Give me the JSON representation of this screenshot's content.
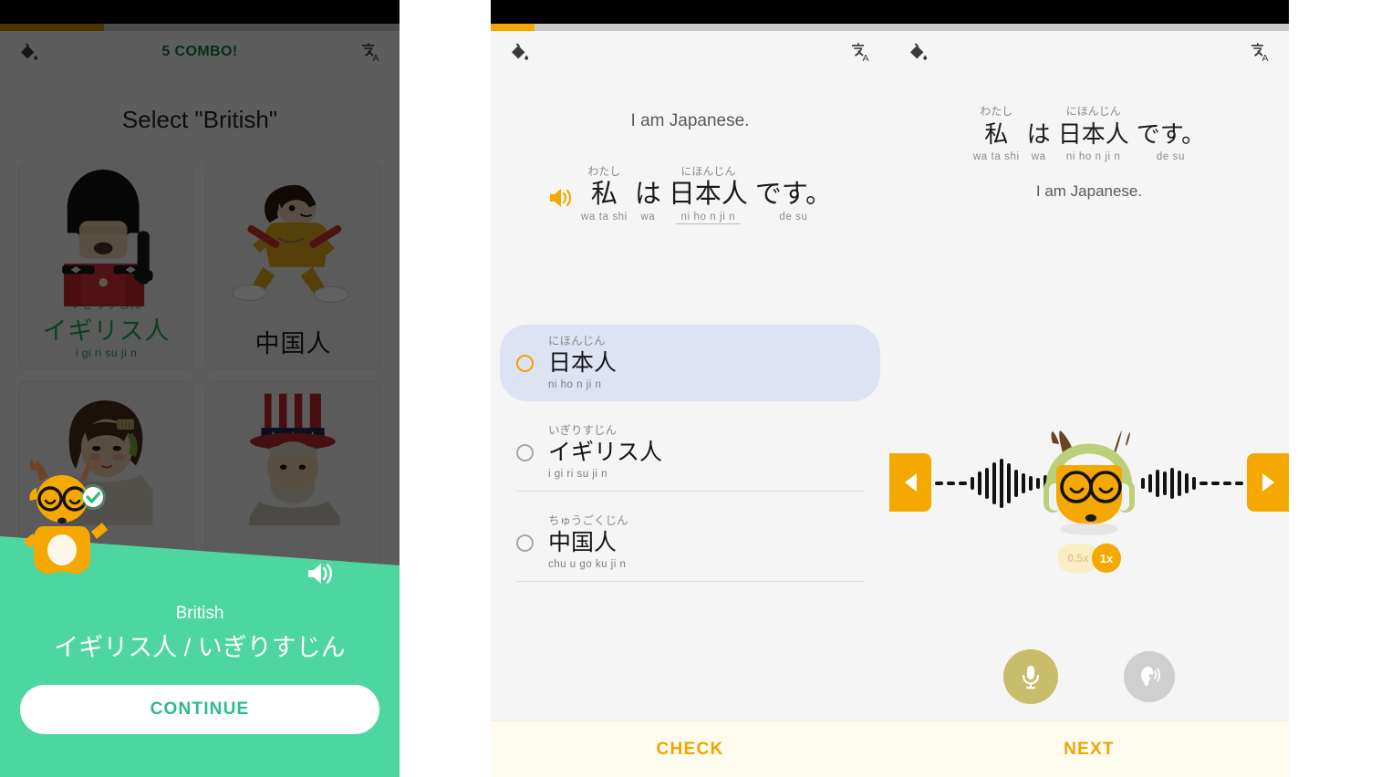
{
  "app": {
    "name": "Japanese learning app",
    "accent_orange": "#f5a800",
    "accent_green": "#4ed6a1",
    "correct_green": "#1fa85f",
    "select_blue": "#dde3f2"
  },
  "panel1": {
    "name": "quiz-result-screen",
    "combo_label": "5 COMBO!",
    "prompt": "Select \"British\"",
    "progress_percent": 26,
    "paint_icon": "paint-bucket-icon",
    "translate_icon": "translate-icon",
    "cards": [
      {
        "furigana": "いぎりすじん",
        "word": "イギリス人",
        "romaji": "i gi ri su ji n",
        "art": "british-guard",
        "selected": true
      },
      {
        "furigana": "",
        "word": "中国人",
        "romaji": "",
        "art": "kungfu-man",
        "selected": false
      },
      {
        "furigana": "",
        "word": "",
        "romaji": "",
        "art": "japanese-woman",
        "selected": false
      },
      {
        "furigana": "",
        "word": "",
        "romaji": "",
        "art": "uncle-sam",
        "selected": false
      }
    ],
    "result": {
      "english": "British",
      "japanese": "イギリス人 / いぎりすじん",
      "continue_label": "CONTINUE",
      "speaker_icon": "speaker-icon",
      "mascot": "deer-mascot-with-check"
    }
  },
  "panel2": {
    "name": "multiple-choice-screen",
    "progress_percent": 11,
    "english": "I am Japanese.",
    "speaker_icon": "speaker-icon",
    "sentence": [
      {
        "furigana": "わたし",
        "kanji": "私",
        "romaji": "wa ta shi",
        "underline": false
      },
      {
        "furigana": "",
        "kanji": "は",
        "romaji": "wa",
        "underline": false
      },
      {
        "furigana": "にほんじん",
        "kanji": "日本人",
        "romaji": "ni ho n ji n",
        "underline": true
      },
      {
        "furigana": "",
        "kanji": "です。",
        "romaji": "de su",
        "underline": false
      }
    ],
    "options": [
      {
        "furigana": "にほんじん",
        "word": "日本人",
        "romaji": "ni ho n ji n",
        "selected": true
      },
      {
        "furigana": "いぎりすじん",
        "word": "イギリス人",
        "romaji": "i gi ri su ji n",
        "selected": false
      },
      {
        "furigana": "ちゅうごくじん",
        "word": "中国人",
        "romaji": "chu u go ku ji n",
        "selected": false
      }
    ],
    "check_label": "CHECK"
  },
  "panel3": {
    "name": "listening-practice-screen",
    "progress_percent": 0,
    "sentence": [
      {
        "furigana": "わたし",
        "kanji": "私",
        "romaji": "wa ta shi"
      },
      {
        "furigana": "",
        "kanji": "は",
        "romaji": "wa"
      },
      {
        "furigana": "にほんじん",
        "kanji": "日本人",
        "romaji": "ni ho n ji n"
      },
      {
        "furigana": "",
        "kanji": "です。",
        "romaji": "de su"
      }
    ],
    "english": "I am Japanese.",
    "speed_half_label": "0.5x",
    "speed_one_label": "1x",
    "mic_icon": "microphone-icon",
    "ear_icon": "ear-listen-icon",
    "prev_icon": "previous-arrow-icon",
    "next_icon": "next-arrow-icon",
    "mascot": "deer-mascot-with-headphones",
    "next_label": "NEXT"
  }
}
